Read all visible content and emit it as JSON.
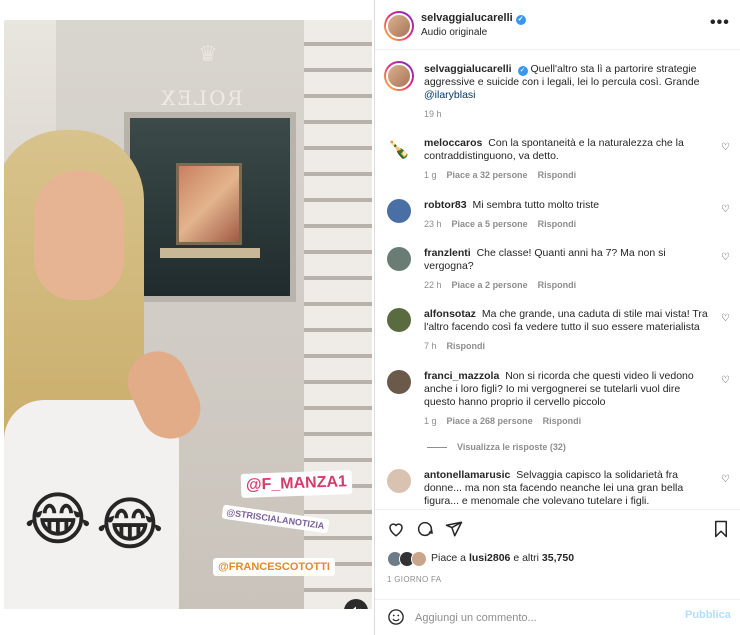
{
  "post": {
    "username": "selvaggialucarelli",
    "audio": "Audio originale",
    "caption_text": "Quell'altro sta lì a partorire strategie aggressive e suicide con i legali, lei lo percula così. Grande ",
    "caption_mention": "@ilaryblasi",
    "caption_time": "19 h"
  },
  "media": {
    "tags": [
      "@F_MANZA1",
      "@STRISCIALANOTIZIA",
      "@FRANCESCOTOTTI"
    ],
    "sign_text": "ROLEX",
    "emojis": [
      "😂",
      "😂"
    ],
    "mute_icon": "speaker-muted-icon"
  },
  "comments": [
    {
      "user": "meloccaros",
      "text": "Con la spontaneità e la naturalezza che la contraddistinguono, va detto.",
      "time": "1 g",
      "likes": "Piace a 32 persone",
      "reply": "Rispondi",
      "avatar_color": "#222222"
    },
    {
      "user": "robtor83",
      "text": "Mi sembra tutto molto triste",
      "time": "23 h",
      "likes": "Piace a 5 persone",
      "reply": "Rispondi",
      "avatar_color": "#4a6fa5"
    },
    {
      "user": "franzlenti",
      "text": "Che classe! Quanti anni ha 7? Ma non si vergogna?",
      "time": "22 h",
      "likes": "Piace a 2 persone",
      "reply": "Rispondi",
      "avatar_color": "#6a7d74"
    },
    {
      "user": "alfonsotaz",
      "text": "Ma che grande, una caduta di stile mai vista! Tra l'altro facendo così fa vedere tutto il suo essere materialista",
      "time": "7 h",
      "likes": "",
      "reply": "Rispondi",
      "avatar_color": "#5a6b3f"
    },
    {
      "user": "franci_mazzola",
      "text": "Non si ricorda che questi video li vedono anche i loro figli? Io mi vergognerei se tutelarli vuol dire questo hanno proprio il cervello piccolo",
      "time": "1 g",
      "likes": "Piace a 268 persone",
      "reply": "Rispondi",
      "avatar_color": "#6b5a4a"
    },
    {
      "user": "antonellamarusic",
      "text": "Selvaggia capisco la solidarietà fra donne... ma non sta facendo neanche lei una gran bella figura... e menomale che volevano tutelare i figli.",
      "time": "",
      "likes": "",
      "reply": "",
      "avatar_color": "#d9c2b0"
    }
  ],
  "view_replies": "Visualizza le risposte (32)",
  "actions": {
    "icons": [
      "heart-icon",
      "comment-icon",
      "share-icon",
      "bookmark-icon"
    ],
    "likes_prefix": "Piace a ",
    "likes_user": "lusi2806",
    "likes_mid": " e altri ",
    "likes_count": "35,750",
    "date": "1 GIORNO FA"
  },
  "add_comment": {
    "placeholder": "Aggiungi un commento...",
    "publish": "Pubblica"
  }
}
